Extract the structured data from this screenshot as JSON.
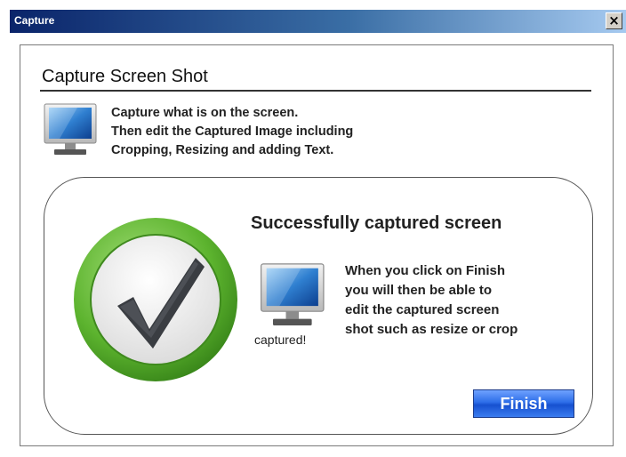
{
  "window": {
    "title": "Capture",
    "close_label": "×"
  },
  "header": {
    "title": "Capture Screen Shot",
    "description": [
      "Capture what is on the screen.",
      "Then edit the Captured Image including",
      "Cropping,  Resizing and adding Text."
    ]
  },
  "result": {
    "title": "Successfully captured screen",
    "captured_label": "captured!",
    "info": [
      "When you click on Finish",
      "you will then be able to",
      "edit the captured screen",
      "shot such as resize or crop"
    ],
    "finish_label": "Finish"
  },
  "colors": {
    "titlebar_start": "#0a246a",
    "titlebar_end": "#a6caf0",
    "check_green": "#5cb32e",
    "finish_blue": "#2c6de8"
  },
  "icons": {
    "monitor": "monitor-icon",
    "check": "checkmark-icon",
    "close": "close-icon"
  }
}
